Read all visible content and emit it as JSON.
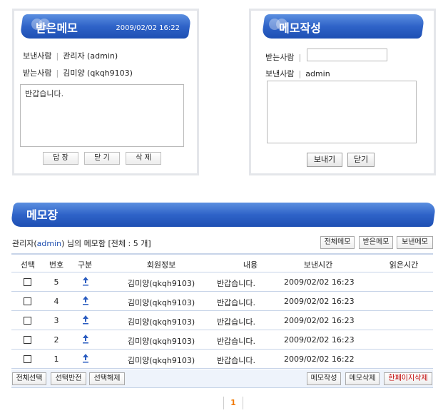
{
  "received": {
    "title": "받은메모",
    "date": "2009/02/02 16:22",
    "sender_label": "보낸사람",
    "sender_value": "관리자 (admin)",
    "receiver_label": "받는사람",
    "receiver_value": "김미양 (qkqh9103)",
    "content": "반갑습니다.",
    "reply_btn": "답 장",
    "close_btn": "닫 기",
    "delete_btn": "삭 제"
  },
  "compose": {
    "title": "메모작성",
    "receiver_label": "받는사람",
    "receiver_value": "",
    "sender_label": "보낸사람",
    "sender_value": "admin",
    "content": "",
    "send_btn": "보내기",
    "close_btn": "닫기"
  },
  "memo": {
    "title": "메모장",
    "summary_prefix": "관리자(",
    "summary_user": "admin",
    "summary_suffix": ") 님의 메모함 [전체 : 5 개]",
    "filter_all": "전체메모",
    "filter_received": "받은메모",
    "filter_sent": "보낸메모",
    "columns": [
      "선택",
      "번호",
      "구분",
      "회원정보",
      "내용",
      "보낸시간",
      "읽은시간"
    ],
    "rows": [
      {
        "num": "5",
        "member": "김미양(qkqh9103)",
        "content": "반갑습니다.",
        "sent": "2009/02/02 16:23",
        "read": ""
      },
      {
        "num": "4",
        "member": "김미양(qkqh9103)",
        "content": "반갑습니다.",
        "sent": "2009/02/02 16:23",
        "read": ""
      },
      {
        "num": "3",
        "member": "김미양(qkqh9103)",
        "content": "반갑습니다.",
        "sent": "2009/02/02 16:23",
        "read": ""
      },
      {
        "num": "2",
        "member": "김미양(qkqh9103)",
        "content": "반갑습니다.",
        "sent": "2009/02/02 16:23",
        "read": ""
      },
      {
        "num": "1",
        "member": "김미양(qkqh9103)",
        "content": "반갑습니다.",
        "sent": "2009/02/02 16:22",
        "read": ""
      }
    ],
    "select_all": "전체선택",
    "select_invert": "선택반전",
    "select_clear": "선택해제",
    "write_btn": "메모작성",
    "delete_btn": "메모삭제",
    "page_delete_btn": "한페이지삭제",
    "page": "1"
  },
  "icons": {
    "direction": "upload-arrow-icon"
  },
  "colors": {
    "accent": "#2f63c8",
    "highlight": "#f07800",
    "danger": "#c00000",
    "link": "#1f4fb0"
  }
}
